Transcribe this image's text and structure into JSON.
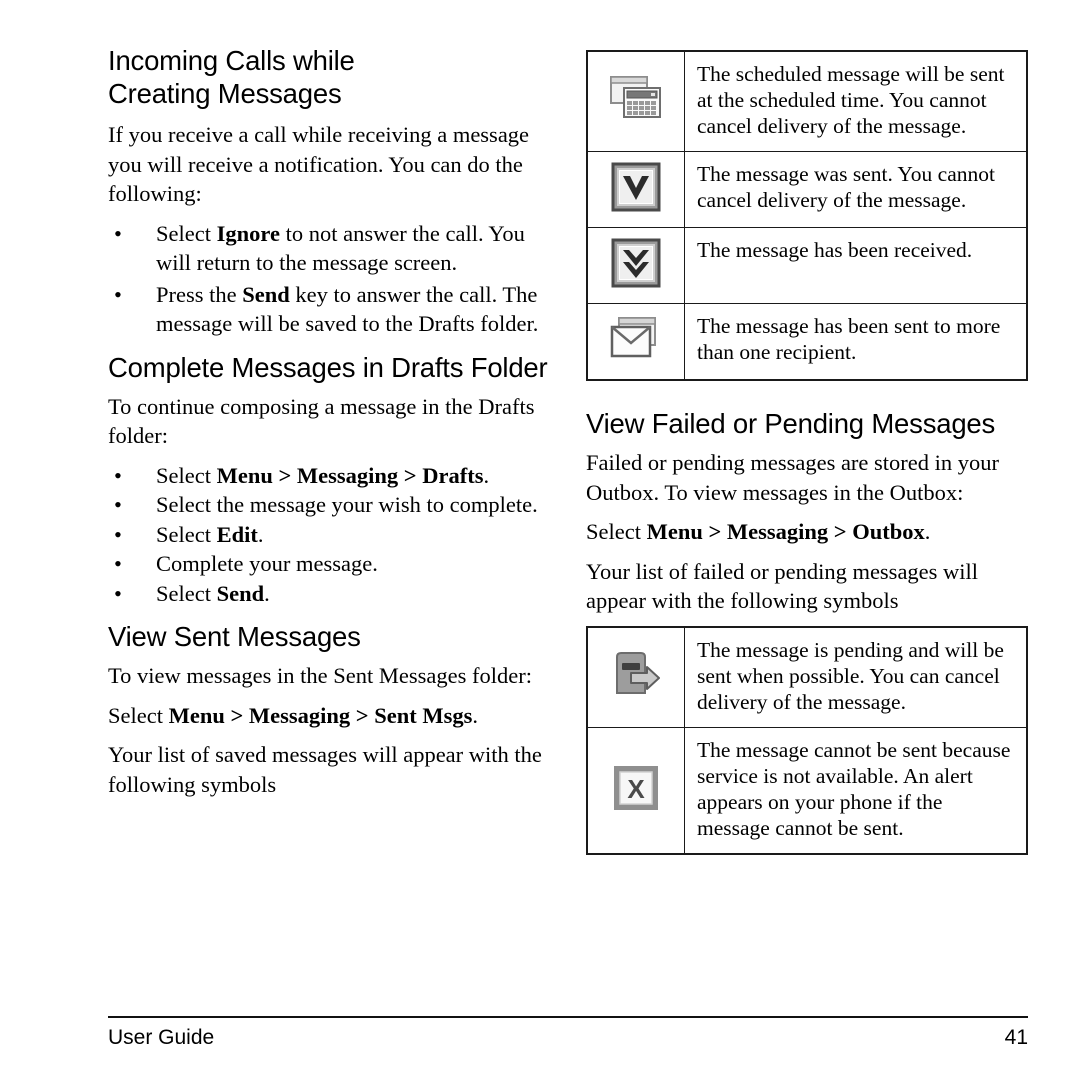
{
  "page": {
    "footer_label": "User Guide",
    "page_number": "41"
  },
  "left_column": {
    "section1": {
      "heading_line1": "Incoming Calls while",
      "heading_line2": "Creating Messages",
      "intro": "If you receive a call while receiving a message you will receive a notification. You can do the following:",
      "bullets": [
        {
          "pre": "Select ",
          "bold": "Ignore",
          "post": " to not answer the call. You will return to the message screen."
        },
        {
          "pre": "Press the ",
          "bold": "Send",
          "post": " key to answer the call. The message will be saved to the Drafts folder."
        }
      ]
    },
    "section2": {
      "heading": "Complete Messages in Drafts Folder",
      "intro": "To continue composing a message in the Drafts folder:",
      "bullets": [
        {
          "pre": "Select ",
          "bold": "Menu > Messaging > Drafts",
          "post": "."
        },
        {
          "pre": "Select the message your wish to complete.",
          "bold": "",
          "post": ""
        },
        {
          "pre": "Select ",
          "bold": "Edit",
          "post": "."
        },
        {
          "pre": "Complete your message.",
          "bold": "",
          "post": ""
        },
        {
          "pre": "Select ",
          "bold": "Send",
          "post": "."
        }
      ]
    },
    "section3": {
      "heading": "View Sent Messages",
      "intro": "To view messages in the Sent Messages folder:",
      "command_pre": "Select ",
      "command_bold": "Menu > Messaging > Sent Msgs",
      "command_post": ".",
      "outro": "Your list of saved messages will appear with the following symbols"
    }
  },
  "right_column": {
    "sent_symbols_table": {
      "rows": [
        {
          "icon": "scheduled-message-icon",
          "text": "The scheduled message will be sent at the scheduled time. You cannot cancel delivery of the message."
        },
        {
          "icon": "check-mark-icon",
          "text": "The message was sent. You cannot cancel delivery of the message."
        },
        {
          "icon": "double-check-mark-icon",
          "text": "The message has been received."
        },
        {
          "icon": "multiple-envelope-icon",
          "text": "The message has been sent to more than one recipient."
        }
      ]
    },
    "section4": {
      "heading": "View Failed or Pending Messages",
      "intro": "Failed or pending messages are stored in your Outbox. To view messages in the Outbox:",
      "command_pre": "Select ",
      "command_bold": "Menu > Messaging > Outbox",
      "command_post": ".",
      "outro": "Your list of failed or pending messages will appear with the following symbols"
    },
    "outbox_symbols_table": {
      "rows": [
        {
          "icon": "pending-outbox-icon",
          "text": "The message is pending and will be sent when possible. You can cancel delivery of the message."
        },
        {
          "icon": "cancel-x-icon",
          "text": "The message cannot be sent because service is not available. An alert appears on your phone if the message cannot be sent."
        }
      ]
    }
  },
  "colors": {
    "text": "#000000",
    "rule": "#111111",
    "table_border": "#1a1a1a",
    "icon_gray_light": "#e8e8e8",
    "icon_gray_mid": "#9a9a9a",
    "icon_gray_dark": "#5a5a5a"
  }
}
